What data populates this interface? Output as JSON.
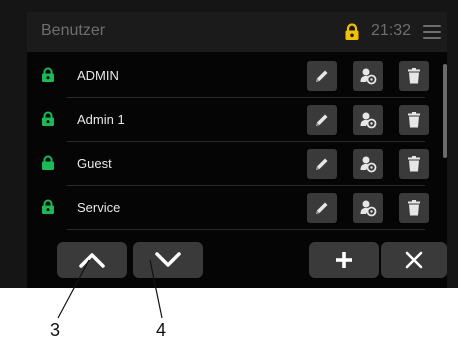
{
  "header": {
    "title": "Benutzer",
    "time": "21:32"
  },
  "users": [
    {
      "name": "ADMIN",
      "lock_color": "#1db954"
    },
    {
      "name": "Admin 1",
      "lock_color": "#1db954"
    },
    {
      "name": "Guest",
      "lock_color": "#1db954"
    },
    {
      "name": "Service",
      "lock_color": "#1db954"
    }
  ],
  "icons": {
    "header_lock": "yellow-lock-icon",
    "menu": "hamburger-menu-icon",
    "edit": "pencil-icon",
    "keys": "user-key-icon",
    "delete": "trash-icon",
    "up": "chevron-up-icon",
    "down": "chevron-down-icon",
    "add": "plus-icon",
    "close": "close-icon"
  },
  "colors": {
    "accent_yellow": "#f2c200",
    "lock_green": "#1db954",
    "button": "#3a3a3a"
  },
  "callouts": {
    "up": "3",
    "down": "4"
  }
}
